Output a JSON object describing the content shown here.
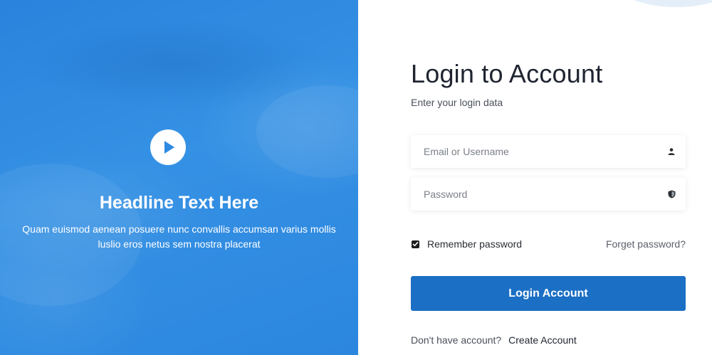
{
  "hero": {
    "headline": "Headline Text Here",
    "text": "Quam euismod aenean posuere nunc convallis accumsan varius mollis luslio eros netus sem nostra placerat",
    "play_icon": "play-icon",
    "background_color": "#2e8ae0"
  },
  "login": {
    "title": "Login to Account",
    "subtitle": "Enter your login data",
    "email": {
      "placeholder": "Email or Username",
      "value": "",
      "icon": "user-icon"
    },
    "password": {
      "placeholder": "Password",
      "value": "",
      "icon": "shield-icon"
    },
    "remember_label": "Remember password",
    "remember_checked": true,
    "forgot_label": "Forget password?",
    "submit_label": "Login Account",
    "signup_prompt": "Don't have account?",
    "signup_link": "Create Account",
    "accent_color": "#1b6fc4"
  }
}
